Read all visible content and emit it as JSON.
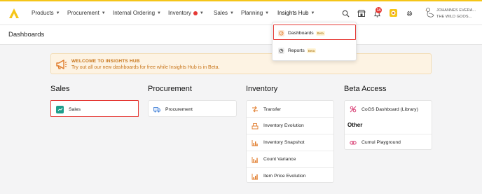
{
  "nav": {
    "items": [
      {
        "label": "Products"
      },
      {
        "label": "Procurement"
      },
      {
        "label": "Internal Ordering"
      },
      {
        "label": "Inventory"
      },
      {
        "label": "Sales"
      },
      {
        "label": "Planning"
      },
      {
        "label": "Insights Hub"
      }
    ],
    "notification_count": "14",
    "user_line1": "JOHANNES EVERA...",
    "user_line2": "THE WILD GOOS..."
  },
  "page": {
    "title": "Dashboards"
  },
  "banner": {
    "title": "WELCOME TO INSIGHTS HUB",
    "text": "Try out all our new dashboards for free while Insights Hub is in Beta."
  },
  "columns": {
    "sales": {
      "title": "Sales",
      "items": [
        {
          "label": "Sales"
        }
      ]
    },
    "procurement": {
      "title": "Procurement",
      "items": [
        {
          "label": "Procurement"
        }
      ]
    },
    "inventory": {
      "title": "Inventory",
      "items": [
        {
          "label": "Transfer"
        },
        {
          "label": "Inventory Evolution"
        },
        {
          "label": "Inventory Snapshot"
        },
        {
          "label": "Count Variance"
        },
        {
          "label": "Item Price Evolution"
        }
      ]
    },
    "beta": {
      "title": "Beta Access",
      "items": [
        {
          "label": "CoGS Dashboard (Library)"
        }
      ],
      "other_title": "Other",
      "other_items": [
        {
          "label": "Cumul Playground"
        }
      ]
    }
  },
  "dropdown": {
    "items": [
      {
        "label": "Dashboards",
        "badge": "Beta"
      },
      {
        "label": "Reports",
        "badge": "Beta"
      }
    ]
  },
  "colors": {
    "accent": "#f5c518",
    "highlight": "#e53935",
    "banner_text": "#c8751a",
    "sales_icon": "#1e9e8c",
    "procurement_icon": "#3a7bd5",
    "inventory_icon": "#e07b2a",
    "beta_icon": "#d6336c"
  }
}
